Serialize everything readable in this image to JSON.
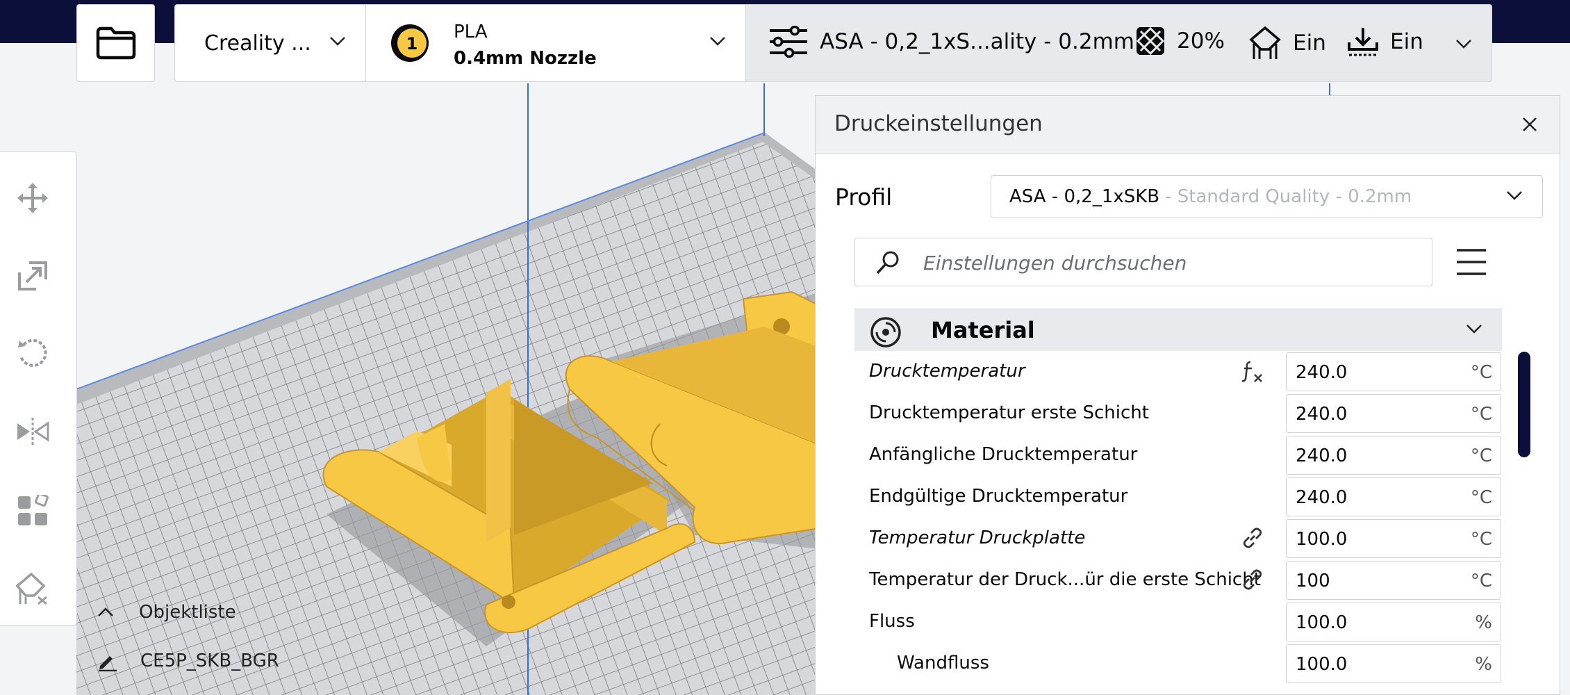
{
  "header": {
    "printer": "Creality ...",
    "material": {
      "badge_number": "1",
      "name": "PLA",
      "nozzle": "0.4mm Nozzle"
    },
    "print_settings": {
      "profile": "ASA - 0,2_1xS...ality - 0.2mm",
      "infill": "20%",
      "support": "Ein",
      "adhesion": "Ein"
    }
  },
  "tools": {
    "move": "move-icon",
    "scale": "scale-icon",
    "rotate": "rotate-icon",
    "mirror": "mirror-icon",
    "per_model": "per-model-settings-icon",
    "support_blocker": "support-blocker-icon"
  },
  "object_list": {
    "label": "Objektliste",
    "object_name": "CE5P_SKB_BGR"
  },
  "settings_panel": {
    "title": "Druckeinstellungen",
    "profile_label": "Profil",
    "profile_name": "ASA - 0,2_1xSKB",
    "profile_detail": "- Standard Quality - 0.2mm",
    "search_placeholder": "Einstellungen durchsuchen",
    "category": {
      "label": "Material",
      "icon": "material-spool-icon"
    },
    "settings": [
      {
        "label": "Drucktemperatur",
        "value": "240.0",
        "unit": "°C",
        "italic": true,
        "icon": "function-icon"
      },
      {
        "label": "Drucktemperatur erste Schicht",
        "value": "240.0",
        "unit": "°C"
      },
      {
        "label": "Anfängliche Drucktemperatur",
        "value": "240.0",
        "unit": "°C"
      },
      {
        "label": "Endgültige Drucktemperatur",
        "value": "240.0",
        "unit": "°C"
      },
      {
        "label": "Temperatur Druckplatte",
        "value": "100.0",
        "unit": "°C",
        "italic": true,
        "icon": "link-icon"
      },
      {
        "label": "Temperatur der Druck...ür die erste Schicht",
        "value": "100",
        "unit": "°C",
        "icon": "link-icon"
      },
      {
        "label": "Fluss",
        "value": "100.0",
        "unit": "%"
      },
      {
        "label": "Wandfluss",
        "value": "100.0",
        "unit": "%",
        "indent": true
      }
    ]
  },
  "colors": {
    "accent_dark": "#0b0f3a",
    "model_yellow": "#f7c843",
    "build_plate": "#c8c9cc"
  }
}
